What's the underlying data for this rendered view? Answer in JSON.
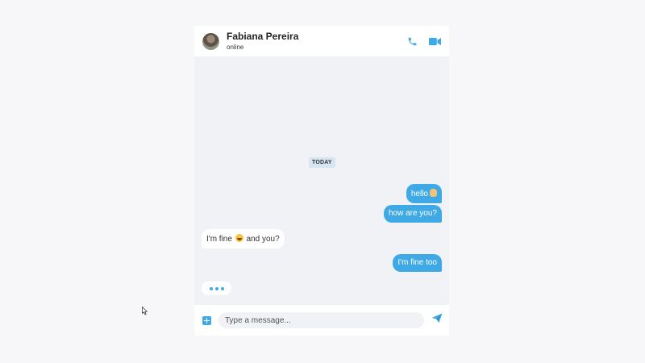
{
  "header": {
    "contact_name": "Fabiana Pereira",
    "status": "online",
    "actions": [
      {
        "icon": "phone-icon"
      },
      {
        "icon": "video-camera-icon"
      }
    ]
  },
  "divider": "TODAY",
  "messages": [
    {
      "from": "me",
      "text": "hello",
      "emoji": "waving-hand"
    },
    {
      "from": "me",
      "text": "how are you?"
    },
    {
      "from": "contact",
      "text_before": "I'm fine",
      "emoji": "grinning-face",
      "text_after": "and you?"
    },
    {
      "from": "me",
      "text": "I'm fine too"
    }
  ],
  "typing_indicator": true,
  "composer": {
    "attach_icon": "plus-square-icon",
    "placeholder": "Type a message...",
    "value": "",
    "send_icon": "send-icon"
  },
  "colors": {
    "accent": "#3fa9e5",
    "chat_background": "#f0f2f5",
    "date_badge": "#d6e5f1",
    "incoming_bubble": "#ffffff"
  }
}
